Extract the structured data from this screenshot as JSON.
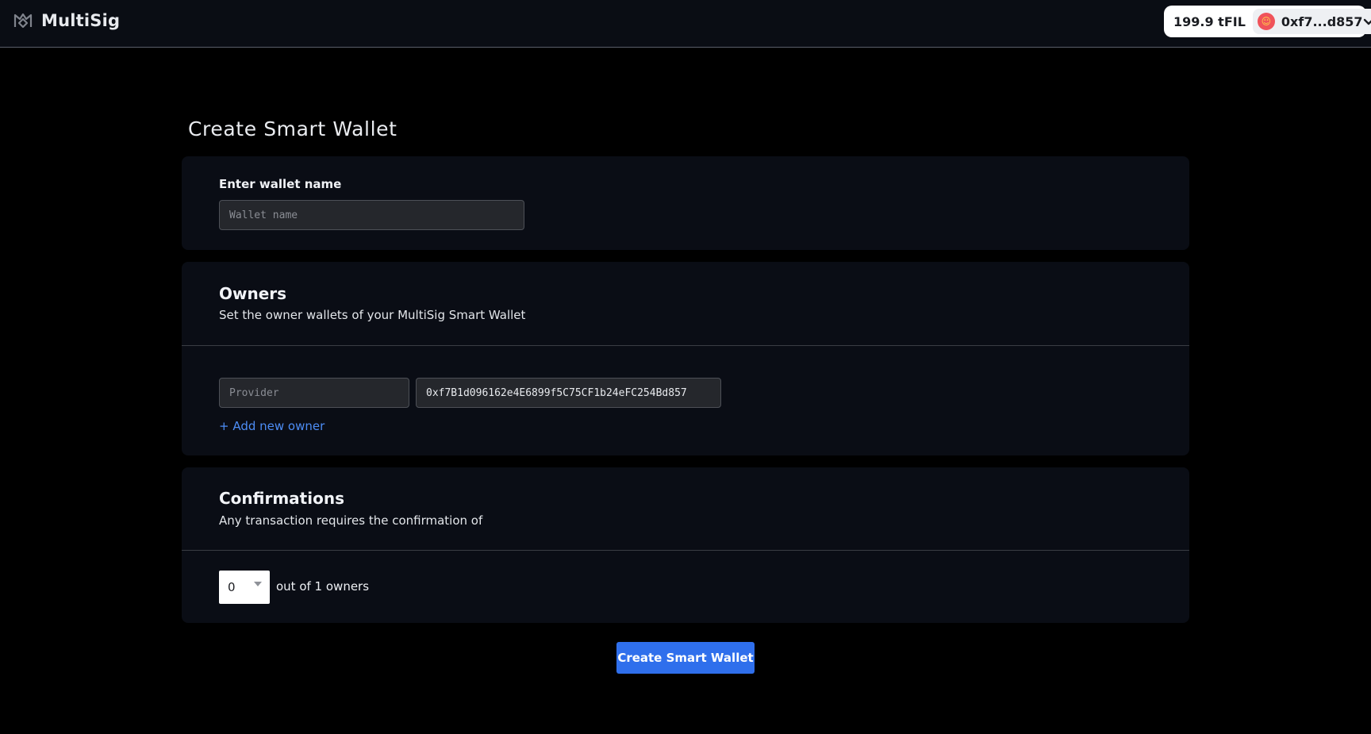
{
  "header": {
    "app_name": "MultiSig",
    "logo_icon": "multisig-logo-icon",
    "balance": "199.9 tFIL",
    "account_short": "0xf7...d857",
    "account_avatar_icon": "avatar-icon",
    "account_chevron_icon": "chevron-down-icon"
  },
  "page": {
    "title": "Create Smart Wallet"
  },
  "wallet_name": {
    "label": "Enter wallet name",
    "placeholder": "Wallet name",
    "value": ""
  },
  "owners": {
    "title": "Owners",
    "description": "Set the owner wallets of your MultiSig Smart Wallet",
    "rows": [
      {
        "provider_placeholder": "Provider",
        "provider_value": "",
        "address_value": "0xf7B1d096162e4E6899f5C75CF1b24eFC254Bd857"
      }
    ],
    "add_owner_label": "+ Add new owner"
  },
  "confirmations": {
    "title": "Confirmations",
    "description": "Any transaction requires the confirmation of",
    "selected": "0",
    "suffix": "out of 1 owners"
  },
  "actions": {
    "create_label": "Create Smart Wallet"
  },
  "colors": {
    "background": "#000000",
    "card": "#0a0d15",
    "accent": "#2f6fec",
    "link": "#4d8df5"
  }
}
